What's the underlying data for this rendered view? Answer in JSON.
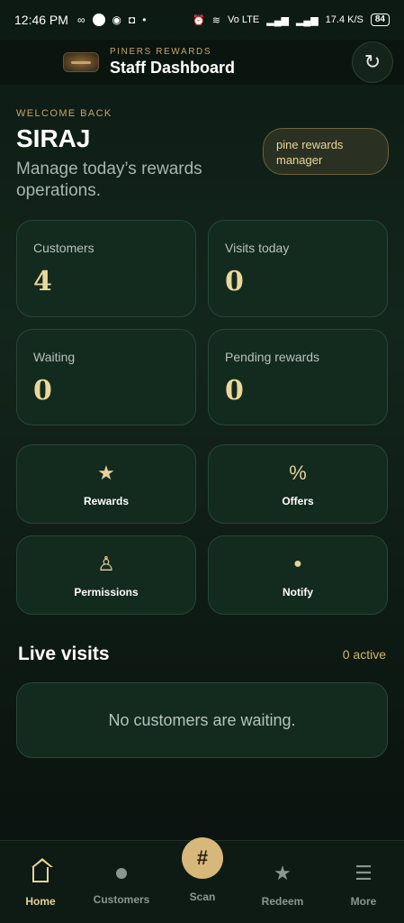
{
  "status_bar": {
    "time": "12:46 PM",
    "network_speed": "17.4 K/S",
    "network_type": "Vo LTE",
    "battery": "84",
    "icons": [
      "infinity-icon",
      "circle-icon",
      "messenger-icon",
      "instagram-icon",
      "dot-icon",
      "alarm-icon",
      "wifi-icon",
      "signal-icon",
      "signal-icon"
    ]
  },
  "app_bar": {
    "brand": "PINERS REWARDS",
    "title": "Staff Dashboard",
    "refresh_icon": "↻"
  },
  "hero": {
    "welcome": "WELCOME BACK",
    "username": "SIRAJ",
    "subtitle": "Manage today’s rewards operations.",
    "role": "pine rewards manager"
  },
  "stats": [
    {
      "label": "Customers",
      "value": "4"
    },
    {
      "label": "Visits today",
      "value": "0"
    },
    {
      "label": "Waiting",
      "value": "0"
    },
    {
      "label": "Pending rewards",
      "value": "0"
    }
  ],
  "actions": [
    {
      "label": "Rewards",
      "icon": "★"
    },
    {
      "label": "Offers",
      "icon": "%"
    },
    {
      "label": "Permissions",
      "icon": "♙"
    },
    {
      "label": "Notify",
      "icon": "●"
    }
  ],
  "live_visits": {
    "title": "Live visits",
    "count": "0 active",
    "empty_message": "No customers are waiting."
  },
  "bottom_nav": {
    "home": "Home",
    "customers": "Customers",
    "scan": "Scan",
    "scan_icon": "#",
    "redeem": "Redeem",
    "redeem_icon": "★",
    "more": "More",
    "more_icon": "☰"
  },
  "colors": {
    "accent_gold": "#d7b87a",
    "background": "#0c1a13",
    "card": "#132a1f"
  }
}
